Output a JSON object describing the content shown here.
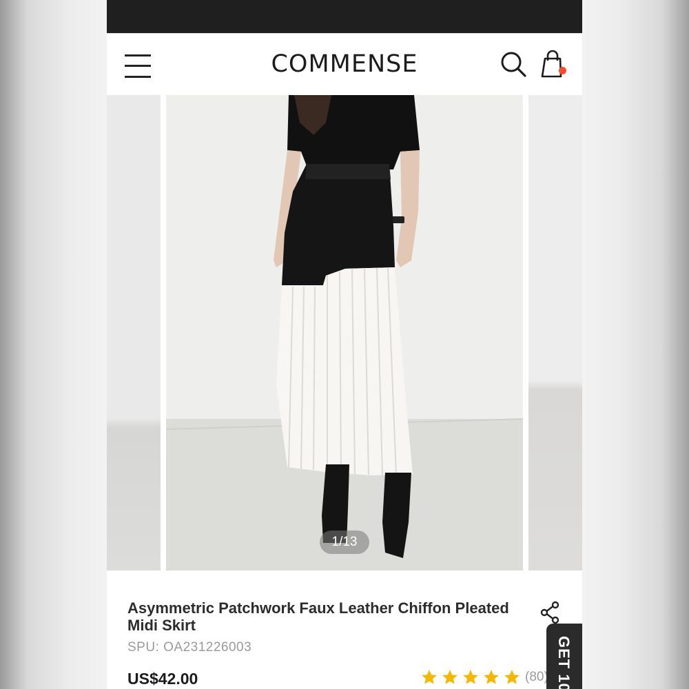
{
  "header": {
    "logo": "COMMENSE",
    "icons": [
      "menu-icon",
      "search-icon",
      "shopping-bag-icon"
    ],
    "cart_badge_color": "#ff4b2b"
  },
  "gallery": {
    "counter": "1/13"
  },
  "product": {
    "title": "Asymmetric Patchwork Faux Leather Chiffon Pleated Midi Skirt",
    "spu": "SPU: OA231226003",
    "price": "US$42.00",
    "rating_stars": 5,
    "reviews": "(80)",
    "star_color": "#f5b800"
  },
  "promo_tab": {
    "label": "GET 10"
  }
}
